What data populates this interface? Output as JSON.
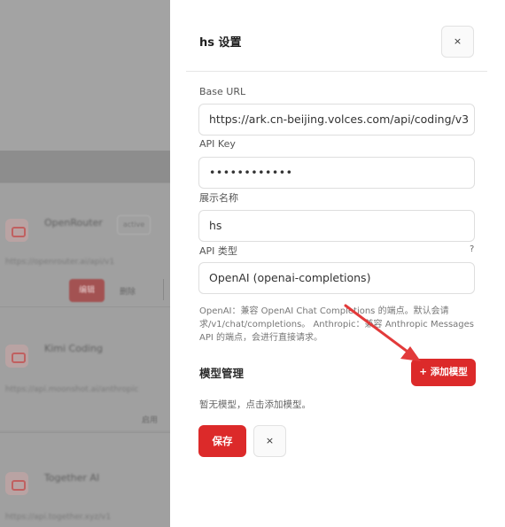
{
  "background_list": {
    "cards": [
      {
        "name": "OpenRouter",
        "url": "https://openrouter.ai/api/v1",
        "tag": "active",
        "primary_action": "编辑",
        "secondary_action": "删除"
      },
      {
        "name": "Kimi Coding",
        "url": "https://api.moonshot.ai/anthropic",
        "tag": "启用"
      },
      {
        "name": "Together AI",
        "url": "https://api.together.xyz/v1"
      }
    ]
  },
  "drawer": {
    "title": "hs 设置",
    "close_label": "×",
    "base_url": {
      "label": "Base URL",
      "value": "https://ark.cn-beijing.volces.com/api/coding/v3"
    },
    "api_key": {
      "label": "API Key",
      "value": "••••••••••••"
    },
    "display_name": {
      "label": "展示名称",
      "value": "hs"
    },
    "api_type": {
      "label": "API 类型",
      "help": "?",
      "value": "OpenAI (openai-completions)"
    },
    "hint": "OpenAI：兼容 OpenAI Chat Completions 的端点。默认会请求/v1/chat/completions。 Anthropic：兼容 Anthropic Messages API 的端点，会进行直接请求。",
    "models": {
      "section_title": "模型管理",
      "add_label": "+ 添加模型",
      "empty_text": "暂无模型，点击添加模型。"
    },
    "save_label": "保存",
    "cancel_label": "×"
  },
  "accent_color": "#dc2a2a",
  "annotation_color": "#e23a3a"
}
